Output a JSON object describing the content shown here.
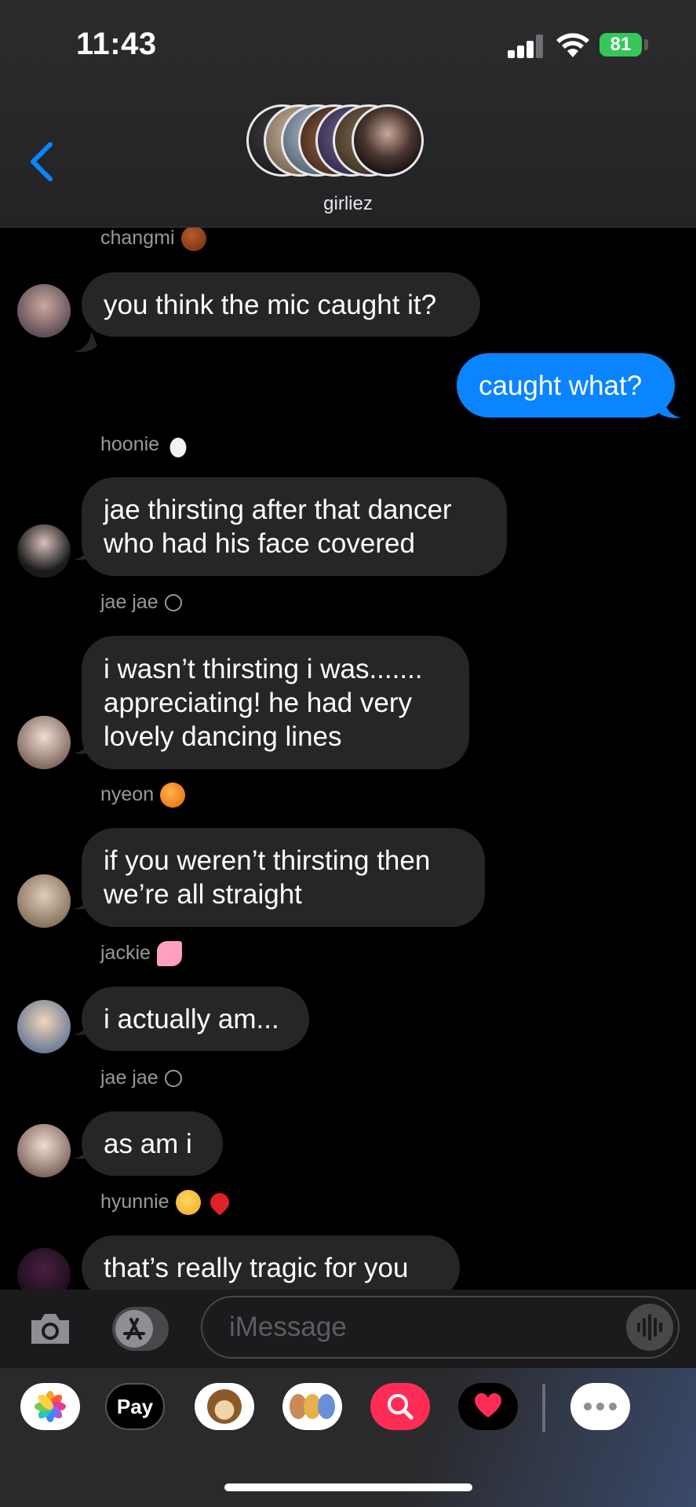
{
  "status_bar": {
    "time": "11:43",
    "battery": "81"
  },
  "header": {
    "group_name": "girliez"
  },
  "messages": [
    {
      "sender": "changmi",
      "text": [
        "you think the mic caught it?"
      ]
    },
    {
      "sender": "me",
      "text": [
        "caught what?"
      ]
    },
    {
      "sender": "hoonie",
      "text": [
        "jae thirsting after that dancer",
        "who had his face covered"
      ]
    },
    {
      "sender": "jae jae",
      "text": [
        "i wasn’t thirsting i was.......",
        "appreciating! he had very",
        "lovely dancing lines"
      ]
    },
    {
      "sender": "nyeon",
      "text": [
        "if you weren’t thirsting then",
        "we’re all straight"
      ]
    },
    {
      "sender": "jackie",
      "text": [
        "i actually am..."
      ]
    },
    {
      "sender": "jae jae",
      "text": [
        "as am i"
      ]
    },
    {
      "sender": "hyunnie",
      "text": [
        "that’s really tragic for you"
      ]
    }
  ],
  "input": {
    "placeholder": "iMessage"
  },
  "apps": [
    {
      "icon": "photos-icon"
    },
    {
      "icon": "apple-pay-icon",
      "label": "Pay"
    },
    {
      "icon": "monkey-memoji-icon"
    },
    {
      "icon": "memoji-stickers-icon"
    },
    {
      "icon": "images-search-icon"
    },
    {
      "icon": "digital-touch-icon"
    },
    {
      "icon": "more-apps-icon"
    }
  ],
  "colors": {
    "accent": "#0a84ff",
    "incoming_bubble": "#262629",
    "battery": "#34c759"
  }
}
